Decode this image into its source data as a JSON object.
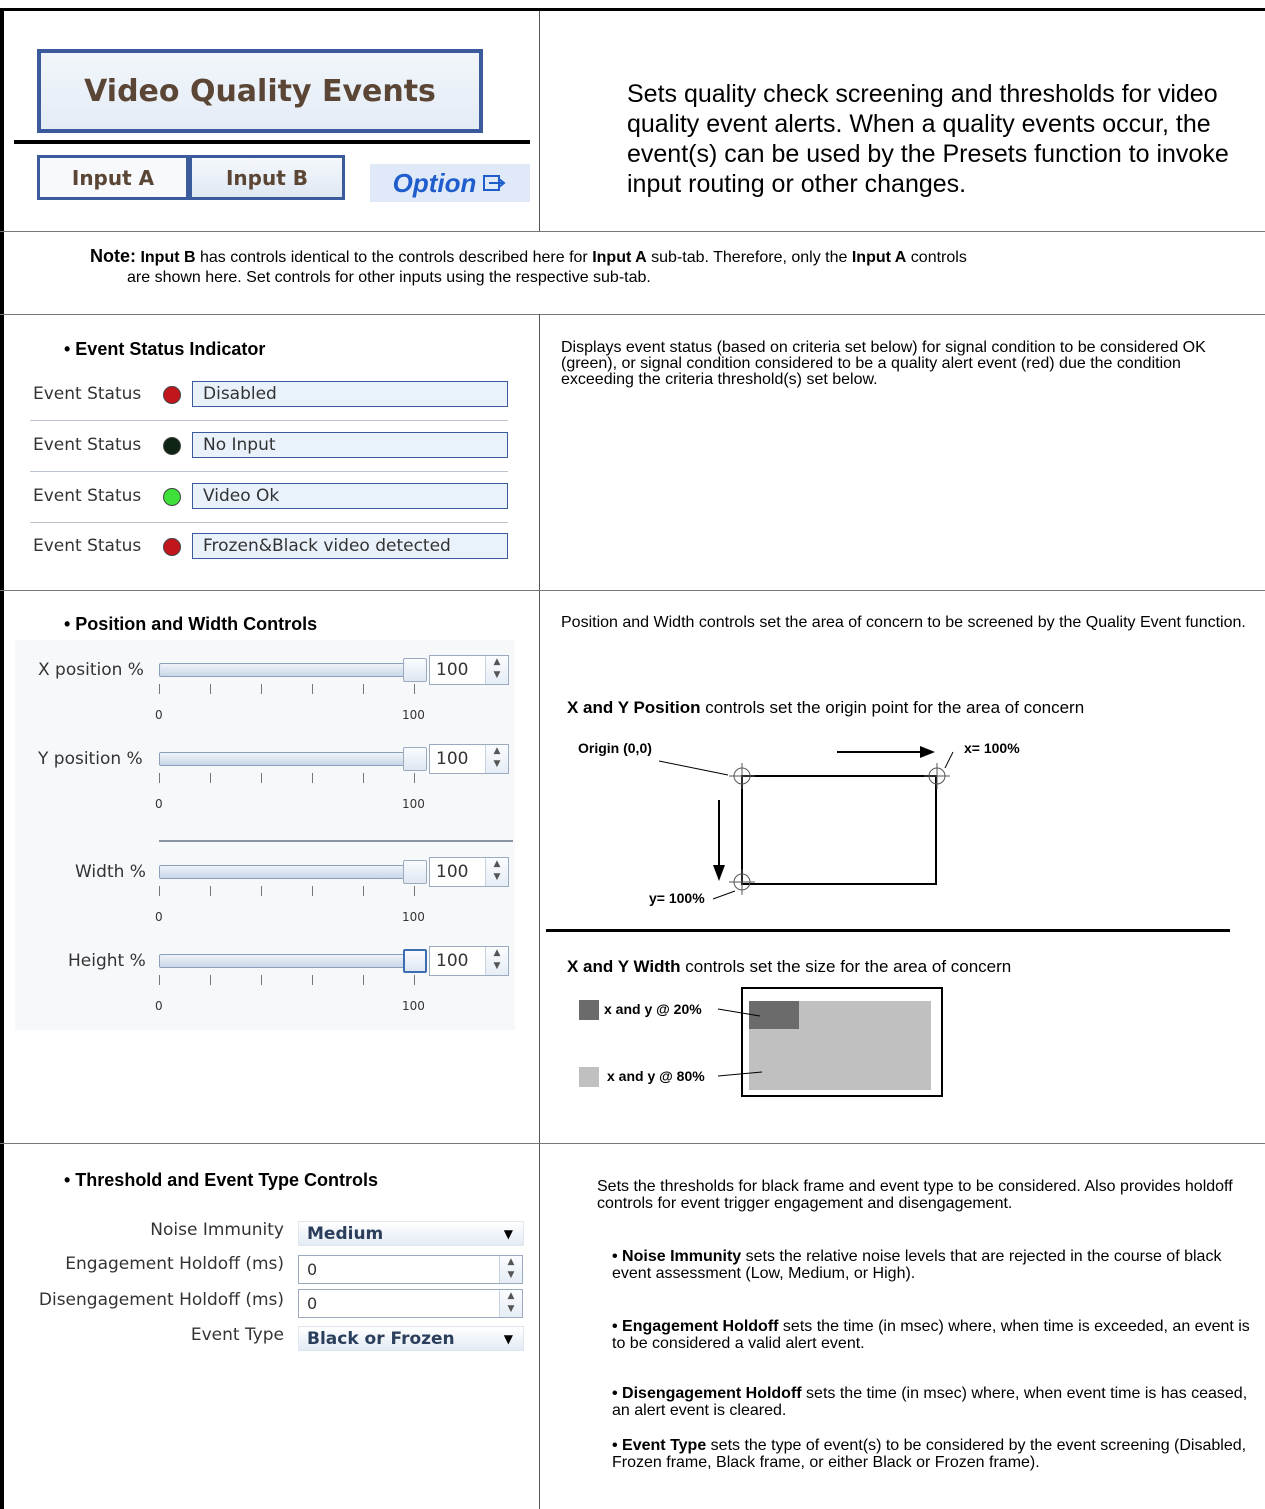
{
  "header": {
    "title": "Video Quality Events",
    "tabs": [
      "Input A",
      "Input B"
    ],
    "option_label": "Option",
    "intro": "Sets quality check screening and thresholds for video quality event alerts. When a quality events occur, the event(s) can be used by the Presets function to invoke input routing or other changes."
  },
  "note": {
    "label": "Note:",
    "t1": "Input B",
    "t2": " has controls identical to the controls described here for ",
    "t3": "Input A",
    "t4": " sub-tab. Therefore, only the ",
    "t5": "Input A",
    "t6": " controls",
    "line2": "are shown here. Set controls for other inputs using the respective sub-tab."
  },
  "status_section": {
    "title": "• Event Status Indicator",
    "rows": [
      {
        "label": "Event Status",
        "value": "Disabled",
        "led_color": "#c0161c"
      },
      {
        "label": "Event Status",
        "value": "No Input",
        "led_color": "#0f2414"
      },
      {
        "label": "Event Status",
        "value": "Video Ok",
        "led_color": "#3ee13a"
      },
      {
        "label": "Event Status",
        "value": "Frozen&Black video detected",
        "led_color": "#c0161c"
      }
    ],
    "description": "Displays event status (based on criteria set below) for signal condition to be considered OK (green), or signal condition considered to be a quality alert event (red) due the condition exceeding the criteria threshold(s) set below."
  },
  "position_section": {
    "title": "• Position and Width Controls",
    "sliders": [
      {
        "label": "X position %",
        "value": "100",
        "level": 1.0,
        "min_label": "0",
        "max_label": "100"
      },
      {
        "label": "Y position %",
        "value": "100",
        "level": 1.0,
        "min_label": "0",
        "max_label": "100"
      },
      {
        "label": "Width %",
        "value": "100",
        "level": 1.0,
        "min_label": "0",
        "max_label": "100"
      },
      {
        "label": "Height %",
        "value": "100",
        "level": 1.0,
        "min_label": "0",
        "max_label": "100"
      }
    ],
    "description": "Position and Width controls set the area of concern to be screened by the Quality Event function.",
    "pos_heading_bold": "X and Y Position",
    "pos_heading_rest": " controls set the origin point for the area of concern",
    "origin_label": "Origin (0,0)",
    "x_label": "x= 100%",
    "y_label": "y= 100%",
    "width_heading_bold": "X and Y Width",
    "width_heading_rest": " controls set the size for the area of concern",
    "small_label": "x and y @ 20%",
    "large_label": "x and y @ 80%",
    "small_color": "#6b6b6b",
    "large_color": "#c0c0c0"
  },
  "threshold_section": {
    "title": "• Threshold and Event Type Controls",
    "noise_label": "Noise Immunity",
    "noise_value": "Medium",
    "engage_label": "Engagement Holdoff (ms)",
    "engage_value": "0",
    "disengage_label": "Disengagement Holdoff (ms)",
    "disengage_value": "0",
    "event_type_label": "Event Type",
    "event_type_value": "Black or Frozen",
    "description": "Sets the thresholds for black frame and event type to be considered. Also provides holdoff controls for event trigger engagement and disengagement.",
    "bullets": [
      {
        "bold": "• Noise Immunity",
        "text": " sets the relative noise levels that are rejected in the course of black event assessment (Low, Medium, or High)."
      },
      {
        "bold": "• Engagement Holdoff",
        "text": " sets the time (in msec) where, when time is exceeded, an event is to be considered a valid alert event."
      },
      {
        "bold": "• Disengagement Holdoff",
        "text": " sets the time (in msec) where, when event time is has ceased, an alert event is cleared."
      },
      {
        "bold": "• Event Type",
        "text": " sets the type of event(s) to be considered by the event screening (Disabled, Frozen frame, Black frame, or either Black or Frozen frame)."
      }
    ]
  }
}
